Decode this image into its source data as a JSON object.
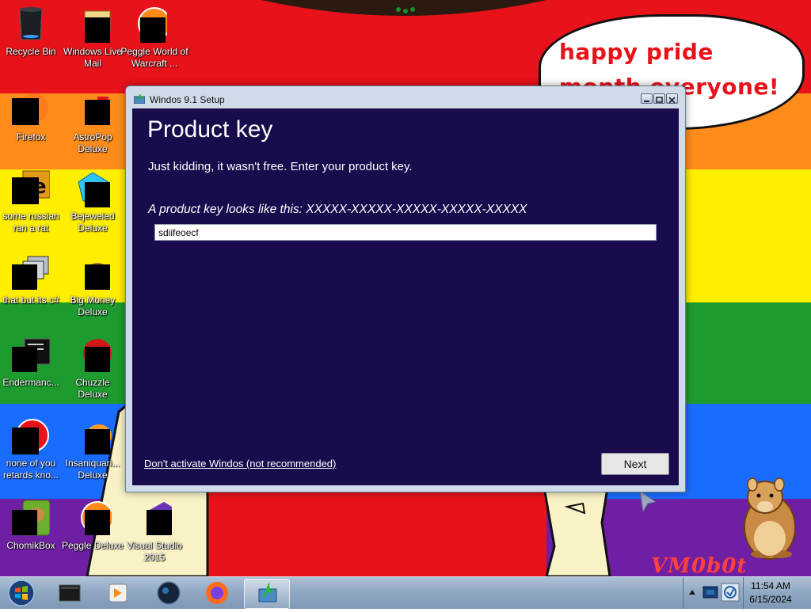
{
  "desktop": {
    "speech_bubble": {
      "text": "happy pride month everyone!"
    },
    "watermark": "VM0b0t",
    "icons": [
      {
        "label": "Recycle Bin"
      },
      {
        "label": "Windows Live Mail"
      },
      {
        "label": "Peggle World of Warcraft ..."
      },
      {
        "label": "Firefox"
      },
      {
        "label": "AstroPop Deluxe"
      },
      {
        "label": "some russian ran a rat"
      },
      {
        "label": "Bejeweled Deluxe"
      },
      {
        "label": "that but its c#"
      },
      {
        "label": "Big Money Deluxe"
      },
      {
        "label": "Endermanc..."
      },
      {
        "label": "Chuzzle Deluxe"
      },
      {
        "label": "none of you retards kno..."
      },
      {
        "label": "Insaniquari... Deluxe"
      },
      {
        "label": "ChomikBox"
      },
      {
        "label": "Peggle Deluxe"
      },
      {
        "label": "Visual Studio 2015"
      }
    ]
  },
  "window": {
    "title": "Windos 9.1 Setup",
    "heading": "Product key",
    "subtext": "Just kidding, it wasn't free. Enter your product key.",
    "hint": "A product key looks like this: XXXXX-XXXXX-XXXXX-XXXXX-XXXXX",
    "key_value": "sdiifeoecf",
    "skip_link": "Don't activate Windos (not recommended)",
    "next_label": "Next"
  },
  "taskbar": {
    "apps": [
      "terminal-icon",
      "media-player-icon",
      "steam-icon",
      "firefox-icon",
      "setup-icon"
    ],
    "active_app": "setup-icon",
    "tray_icons": [
      "show-hidden-icon",
      "network-icon",
      "antivirus-icon"
    ],
    "clock": {
      "time": "11:54 AM",
      "date": "6/15/2024"
    }
  },
  "colors": {
    "setup_background": "#1a0b4d",
    "rainbow": [
      "#e8121a",
      "#ff8c1a",
      "#ffee00",
      "#1e9b2e",
      "#1a6cff",
      "#6e1fa3"
    ]
  }
}
